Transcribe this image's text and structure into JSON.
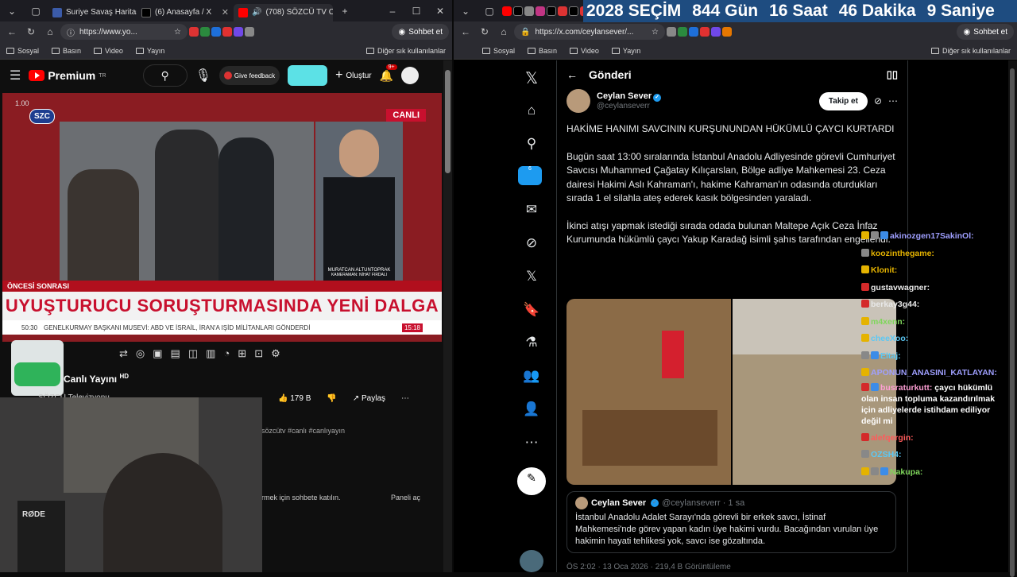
{
  "left_window": {
    "tabs": [
      {
        "label": "Suriye Savaş Haritası - S",
        "fav_color": "#3b5ba9"
      },
      {
        "label": "(6) Anasayfa / X",
        "fav_color": "#000000"
      },
      {
        "label": "(708) SÖZCÜ TV Ca",
        "fav_color": "#ff0000",
        "active": true
      }
    ],
    "url": "https://www.yo...",
    "chat_button": "Sohbet et",
    "bookmarks": [
      "Sosyal",
      "Basın",
      "Video",
      "Yayın"
    ],
    "other_bookmarks": "Diğer sık kullanılanlar"
  },
  "youtube": {
    "logo": "Premium",
    "logo_sup": "TR",
    "feedback": "Give feedback",
    "create": "Oluştur",
    "notif_count": "9+",
    "player": {
      "speed": "1.00",
      "channel_bug": "SZC",
      "live_tag": "CANLI",
      "reporter_name": "MURATCAN ALTUNTOPRAK",
      "reporter_sub": "KAMERAMAN: NİHAT FIRDALI",
      "segment": "ÖNCESİ SONRASI",
      "headline": "UYUŞTURUCU SORUŞTURMASINDA YENİ DALGA",
      "ticker": "GENELKURMAY BAŞKANI MUSEVİ: ABD VE İSRAİL, İRAN'A IŞİD MİLİTANLARI GÖNDERDİ",
      "ticker_time": "15:18",
      "ticker_left": "50:30"
    },
    "title": "Canlı Yayını",
    "title_badge": "HD",
    "channel": "SÖZCÜ Televizyonu",
    "likes": "179 B",
    "share": "Paylaş",
    "hashtags": "sözcütv #canlı #canlıyayın",
    "chat_prompt": "rmek için sohbete katılın.",
    "panel_open": "Paneli aç",
    "webcam_label": "RØDE"
  },
  "countdown": {
    "year": "2028",
    "label": "SEÇİM",
    "days": "844",
    "days_unit": "Gün",
    "hours": "16",
    "hours_unit": "Saat",
    "minutes": "46",
    "minutes_unit": "Dakika",
    "seconds": "9",
    "seconds_unit": "Saniye"
  },
  "right_window": {
    "url": "https://x.com/ceylansever/...",
    "chat_button": "Sohbet et",
    "bookmarks": [
      "Sosyal",
      "Basın",
      "Video",
      "Yayın"
    ],
    "other_bookmarks": "Diğer sık kullanılanlar"
  },
  "x": {
    "header": "Gönderi",
    "notif_badge": "6",
    "author_name": "Ceylan Sever",
    "author_handle": "@ceylanseverr",
    "follow": "Takip et",
    "paragraphs": [
      "HAKİME HANIMI SAVCININ KURŞUNUNDAN HÜKÜMLÜ ÇAYCI KURTARDI",
      "Bugün saat 13:00 sıralarında İstanbul Anadolu Adliyesinde görevli Cumhuriyet Savcısı Muhammed Çağatay Kılıçarslan, Bölge adliye Mahkemesi 23. Ceza dairesi Hakimi Aslı Kahraman'ı, hakime Kahraman'ın odasında oturdukları sırada 1 el silahla ateş ederek kasık bölgesinden yaraladı.",
      "İkinci atışı yapmak istediği sırada odada bulunan Maltepe Açık Ceza İnfaz Kurumunda hükümlü çaycı Yakup Karadağ isimli şahıs tarafından engellendi."
    ],
    "quote": {
      "name": "Ceylan Sever",
      "handle": "@ceylanseverr · 1 sa",
      "text": "İstanbul Anadolu Adalet Sarayı'nda görevli bir erkek savcı, İstinaf Mahkemesi'nde görev yapan kadın üye hakimi vurdu. Bacağından vurulan üye hakimin hayati tehlikesi yok, savcı ise gözaltında."
    },
    "timestamp": "ÖS 2:02 · 13 Oca 2026 · 219,4 B Görüntüleme"
  },
  "stream_chat": [
    {
      "user": "akinozgen17SakinOl:",
      "color": "#9f9fff",
      "icons": [
        "gold",
        "tv",
        "gift"
      ]
    },
    {
      "user": "koozinthegame:",
      "color": "#e5b300",
      "icons": [
        "tv"
      ]
    },
    {
      "user": "Klonit:",
      "color": "#e5b300",
      "icons": [
        "gold"
      ]
    },
    {
      "user": "gustavwagner:",
      "color": "#e8e8e8",
      "icons": [
        "red"
      ]
    },
    {
      "user": "berkay3g44:",
      "color": "#e8e8e8",
      "icons": [
        "red"
      ]
    },
    {
      "user": "m4xenn:",
      "color": "#7fd65b",
      "icons": [
        "gold"
      ]
    },
    {
      "user": "cheeXoo:",
      "color": "#5bc8f5",
      "icons": [
        "gold"
      ]
    },
    {
      "user": "Eltaj:",
      "color": "#5bc8f5",
      "icons": [
        "tv",
        "gift"
      ]
    },
    {
      "user": "APONUN_ANASINI_KATLAYAN:",
      "color": "#9f9fff",
      "icons": [
        "gold"
      ]
    },
    {
      "user": "busraturkutt:",
      "color": "#ff9fd5",
      "icons": [
        "red",
        "gift"
      ],
      "text": "çaycı hükümlü olan insan topluma kazandırılmak için adliyelerde istihdam ediliyor değil mi"
    },
    {
      "user": "alefqergin:",
      "color": "#ff5a5a",
      "icons": [
        "red"
      ]
    },
    {
      "user": "OZSH4:",
      "color": "#5bc8f5",
      "icons": [
        "tv"
      ]
    },
    {
      "user": "Nakupa:",
      "color": "#7fd65b",
      "icons": [
        "gold",
        "tv",
        "gift"
      ]
    }
  ]
}
